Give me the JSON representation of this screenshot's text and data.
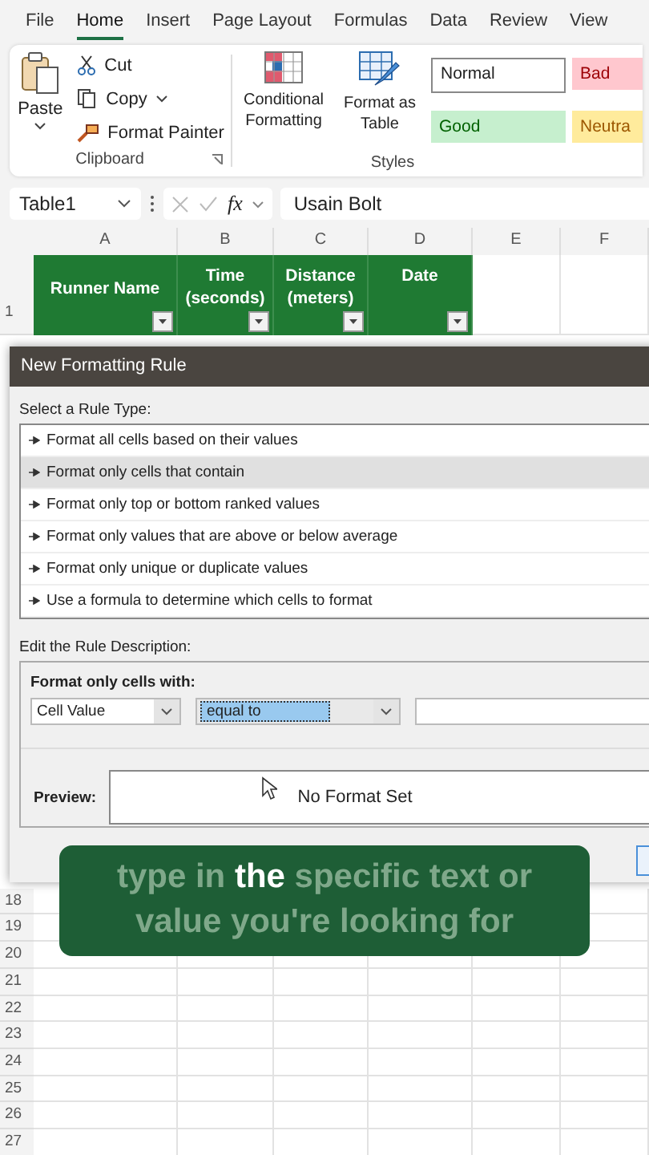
{
  "ribbon_tabs": [
    {
      "label": "File",
      "selected": false
    },
    {
      "label": "Home",
      "selected": true
    },
    {
      "label": "Insert",
      "selected": false
    },
    {
      "label": "Page Layout",
      "selected": false
    },
    {
      "label": "Formulas",
      "selected": false
    },
    {
      "label": "Data",
      "selected": false
    },
    {
      "label": "Review",
      "selected": false
    },
    {
      "label": "View",
      "selected": false
    }
  ],
  "clipboard": {
    "paste": "Paste",
    "cut": "Cut",
    "copy": "Copy",
    "format_painter": "Format Painter",
    "label": "Clipboard"
  },
  "styles_group": {
    "conditional_formatting": "Conditional Formatting",
    "format_as_table": "Format as Table",
    "label": "Styles",
    "cell_styles": [
      {
        "label": "Normal",
        "kind": "normal"
      },
      {
        "label": "Bad",
        "kind": "bad"
      },
      {
        "label": "Good",
        "kind": "good"
      },
      {
        "label": "Neutra",
        "kind": "neutral"
      }
    ]
  },
  "formula_bar": {
    "name_box": "Table1",
    "function_label": "fx",
    "value": "Usain Bolt"
  },
  "sheet": {
    "columns": [
      "A",
      "B",
      "C",
      "D",
      "E",
      "F"
    ],
    "header_row": {
      "number": "1",
      "cells": [
        "Runner Name",
        "Time (seconds)",
        "Distance (meters)",
        "Date"
      ]
    },
    "row_numbers": [
      "18",
      "19",
      "20",
      "21",
      "22",
      "23",
      "24",
      "25",
      "26",
      "27"
    ]
  },
  "dialog": {
    "title": "New Formatting Rule",
    "rule_type_label": "Select a Rule Type:",
    "rule_types": [
      {
        "label": "Format all cells based on their values",
        "selected": false
      },
      {
        "label": "Format only cells that contain",
        "selected": true
      },
      {
        "label": "Format only top or bottom ranked values",
        "selected": false
      },
      {
        "label": "Format only values that are above or below average",
        "selected": false
      },
      {
        "label": "Format only unique or duplicate values",
        "selected": false
      },
      {
        "label": "Use a formula to determine which cells to format",
        "selected": false
      }
    ],
    "description_label": "Edit the Rule Description:",
    "condition_label": "Format only cells with:",
    "condition": {
      "field": "Cell Value",
      "operator": "equal to",
      "operator_highlighted": true
    },
    "preview_label": "Preview:",
    "preview_text": "No Format Set"
  },
  "caption": "type in **the** specific text or value you're looking for"
}
